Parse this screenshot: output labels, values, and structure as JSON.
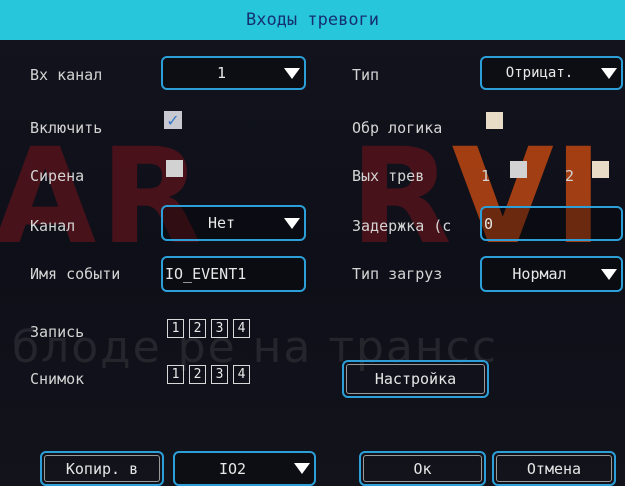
{
  "window": {
    "title": "Входы тревоги"
  },
  "watermark": {
    "left": "AR",
    "right_r": "R",
    "right_vi": "VI",
    "subtitle": "блоде   ре на трансс"
  },
  "left": {
    "channel_label": "Вх канал",
    "channel_value": "1",
    "enable_label": "Включить",
    "enable_checked": true,
    "enable_mark": "✓",
    "siren_label": "Сирена",
    "camera_label": "Канал",
    "camera_value": "Нет",
    "event_name_label": "Имя событи",
    "event_name_value": "IO_EVENT1",
    "record_label": "Запись",
    "snapshot_label": "Снимок",
    "channels": [
      "1",
      "2",
      "3",
      "4"
    ]
  },
  "right": {
    "type_label": "Тип",
    "type_value": "Отрицат.",
    "reverse_logic_label": "Обр логика",
    "alarm_out_label": "Вых трев",
    "alarm_out_1": "1",
    "alarm_out_2": "2",
    "delay_label": "Задержка (с",
    "delay_value": "0",
    "upload_type_label": "Тип загруз",
    "upload_type_value": "Нормал",
    "settings_button": "Настройка"
  },
  "footer": {
    "copy_to_label": "Копир. в",
    "copy_target_value": "IO2",
    "ok_label": "Ок",
    "cancel_label": "Отмена"
  },
  "colors": {
    "title_bg": "#28c6da",
    "title_text": "#14306e",
    "field_border": "#2d9fd8",
    "background": "#0b0c14"
  }
}
